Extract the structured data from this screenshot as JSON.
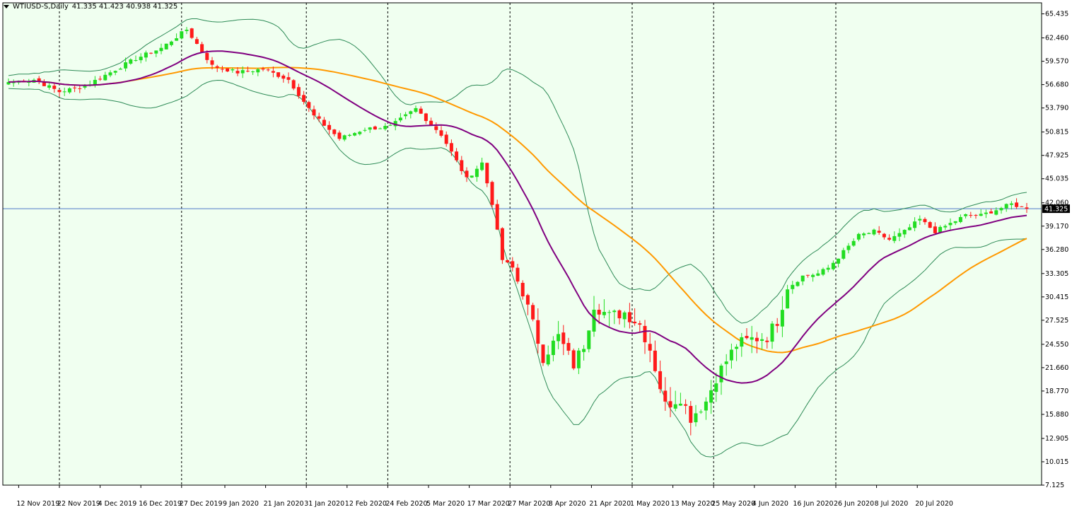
{
  "header": {
    "symbol": "WTIUSD-S,Daily",
    "ohlc": "41.335 41.423 40.938 41.325"
  },
  "colors": {
    "background": "#f0fff0",
    "bull": "#22dd22",
    "bear": "#ff1a1a",
    "bollinger": "#2e8b57",
    "ma_fast": "#800080",
    "ma_slow": "#ff9900",
    "price_line": "#4f7ac9"
  },
  "chart_data": {
    "type": "candlestick",
    "instrument": "WTIUSD-S",
    "timeframe": "Daily",
    "last_price": "41.325",
    "ylim": [
      7.125,
      66.8
    ],
    "y_ticks": [
      "65.435",
      "62.460",
      "59.570",
      "56.680",
      "53.790",
      "50.815",
      "47.925",
      "45.035",
      "42.060",
      "39.170",
      "36.280",
      "33.305",
      "30.415",
      "27.525",
      "24.550",
      "21.660",
      "18.770",
      "15.880",
      "12.905",
      "10.015",
      "7.125"
    ],
    "x_ticks": [
      "12 Nov 2019",
      "22 Nov 2019",
      "4 Dec 2019",
      "16 Dec 2019",
      "27 Dec 2019",
      "9 Jan 2020",
      "21 Jan 2020",
      "31 Jan 2020",
      "12 Feb 2020",
      "24 Feb 2020",
      "5 Mar 2020",
      "17 Mar 2020",
      "27 Mar 2020",
      "8 Apr 2020",
      "21 Apr 2020",
      "1 May 2020",
      "13 May 2020",
      "25 May 2020",
      "4 Jun 2020",
      "16 Jun 2020",
      "26 Jun 2020",
      "8 Jul 2020",
      "20 Jul 2020"
    ],
    "period_separators": [
      "22 Nov 2019",
      "27 Dec 2019",
      "31 Jan 2020",
      "24 Feb 2020",
      "27 Mar 2020",
      "1 May 2020",
      "25 May 2020",
      "26 Jun 2020"
    ],
    "close_anchors": [
      [
        0,
        57.0
      ],
      [
        5,
        57.3
      ],
      [
        10,
        55.8
      ],
      [
        15,
        56.5
      ],
      [
        20,
        58.2
      ],
      [
        25,
        59.9
      ],
      [
        30,
        61.2
      ],
      [
        35,
        63.5
      ],
      [
        40,
        59.0
      ],
      [
        45,
        58.2
      ],
      [
        50,
        58.6
      ],
      [
        55,
        57.3
      ],
      [
        60,
        52.8
      ],
      [
        65,
        50.0
      ],
      [
        70,
        51.2
      ],
      [
        75,
        51.5
      ],
      [
        80,
        53.7
      ],
      [
        85,
        50.5
      ],
      [
        90,
        45.0
      ],
      [
        93,
        47.0
      ],
      [
        95,
        42.0
      ],
      [
        97,
        35.0
      ],
      [
        99,
        34.0
      ],
      [
        102,
        29.0
      ],
      [
        105,
        23.0
      ],
      [
        108,
        25.5
      ],
      [
        111,
        22.0
      ],
      [
        113,
        24.5
      ],
      [
        115,
        29.5
      ],
      [
        118,
        28.0
      ],
      [
        121,
        28.5
      ],
      [
        124,
        27.0
      ],
      [
        126,
        24.0
      ],
      [
        129,
        17.0
      ],
      [
        132,
        18.0
      ],
      [
        134,
        15.5
      ],
      [
        137,
        17.5
      ],
      [
        139,
        20.5
      ],
      [
        141,
        22.5
      ],
      [
        143,
        24.5
      ],
      [
        146,
        25.2
      ],
      [
        149,
        25.5
      ],
      [
        151,
        27.5
      ],
      [
        153,
        31.5
      ],
      [
        156,
        33.0
      ],
      [
        159,
        33.3
      ],
      [
        161,
        34.0
      ],
      [
        164,
        36.0
      ],
      [
        167,
        38.0
      ],
      [
        170,
        38.5
      ],
      [
        173,
        37.5
      ],
      [
        176,
        38.5
      ],
      [
        179,
        40.0
      ],
      [
        182,
        38.5
      ],
      [
        185,
        39.5
      ],
      [
        188,
        40.5
      ],
      [
        191,
        40.5
      ],
      [
        194,
        41.2
      ],
      [
        197,
        41.9
      ],
      [
        200,
        41.325
      ]
    ],
    "indicators": [
      "Bollinger Bands (20)",
      "Moving Average (fast)",
      "Moving Average (slow)"
    ]
  }
}
